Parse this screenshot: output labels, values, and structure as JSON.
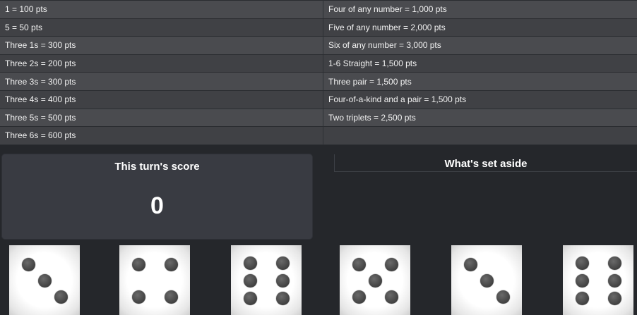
{
  "scoring_rules": [
    {
      "left": "1 = 100 pts",
      "right": "Four of any number = 1,000 pts"
    },
    {
      "left": "5 = 50 pts",
      "right": "Five of any number = 2,000 pts"
    },
    {
      "left": "Three 1s = 300 pts",
      "right": "Six of any number = 3,000 pts"
    },
    {
      "left": "Three 2s = 200 pts",
      "right": "1-6 Straight = 1,500 pts"
    },
    {
      "left": "Three 3s = 300 pts",
      "right": "Three pair = 1,500 pts"
    },
    {
      "left": "Three 4s = 400 pts",
      "right": "Four-of-a-kind and a pair = 1,500 pts"
    },
    {
      "left": "Three 5s = 500 pts",
      "right": "Two triplets = 2,500 pts"
    },
    {
      "left": "Three 6s = 600 pts",
      "right": ""
    }
  ],
  "turn_score": {
    "title": "This turn's score",
    "value": "0"
  },
  "set_aside": {
    "title": "What's set aside"
  },
  "dice": [
    3,
    4,
    6,
    5,
    3,
    6
  ]
}
